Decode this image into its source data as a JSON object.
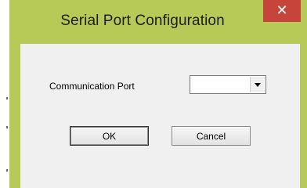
{
  "window": {
    "title": "Serial Port Configuration",
    "accent_color": "#b7c957",
    "close_button_color": "#c7443a"
  },
  "titlebar": {
    "close_icon": "close-icon",
    "close_glyph": "✕"
  },
  "form": {
    "port_label": "Communication Port",
    "port_value": "",
    "port_dropdown_icon": "chevron-down-icon"
  },
  "buttons": {
    "ok_label": "OK",
    "cancel_label": "Cancel"
  }
}
